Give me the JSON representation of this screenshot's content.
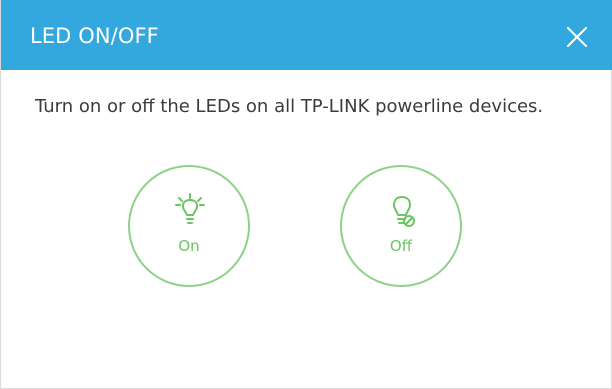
{
  "dialog": {
    "title": "LED ON/OFF",
    "close_icon": "close-icon",
    "description": "Turn on or off the LEDs on all TP-LINK powerline devices.",
    "options": [
      {
        "label": "On",
        "icon": "lightbulb-on-icon"
      },
      {
        "label": "Off",
        "icon": "lightbulb-off-icon"
      }
    ]
  },
  "colors": {
    "header": "#32a8df",
    "accent_green": "#6bc565",
    "circle_border": "#8bd386",
    "text": "#3b3b3b"
  }
}
